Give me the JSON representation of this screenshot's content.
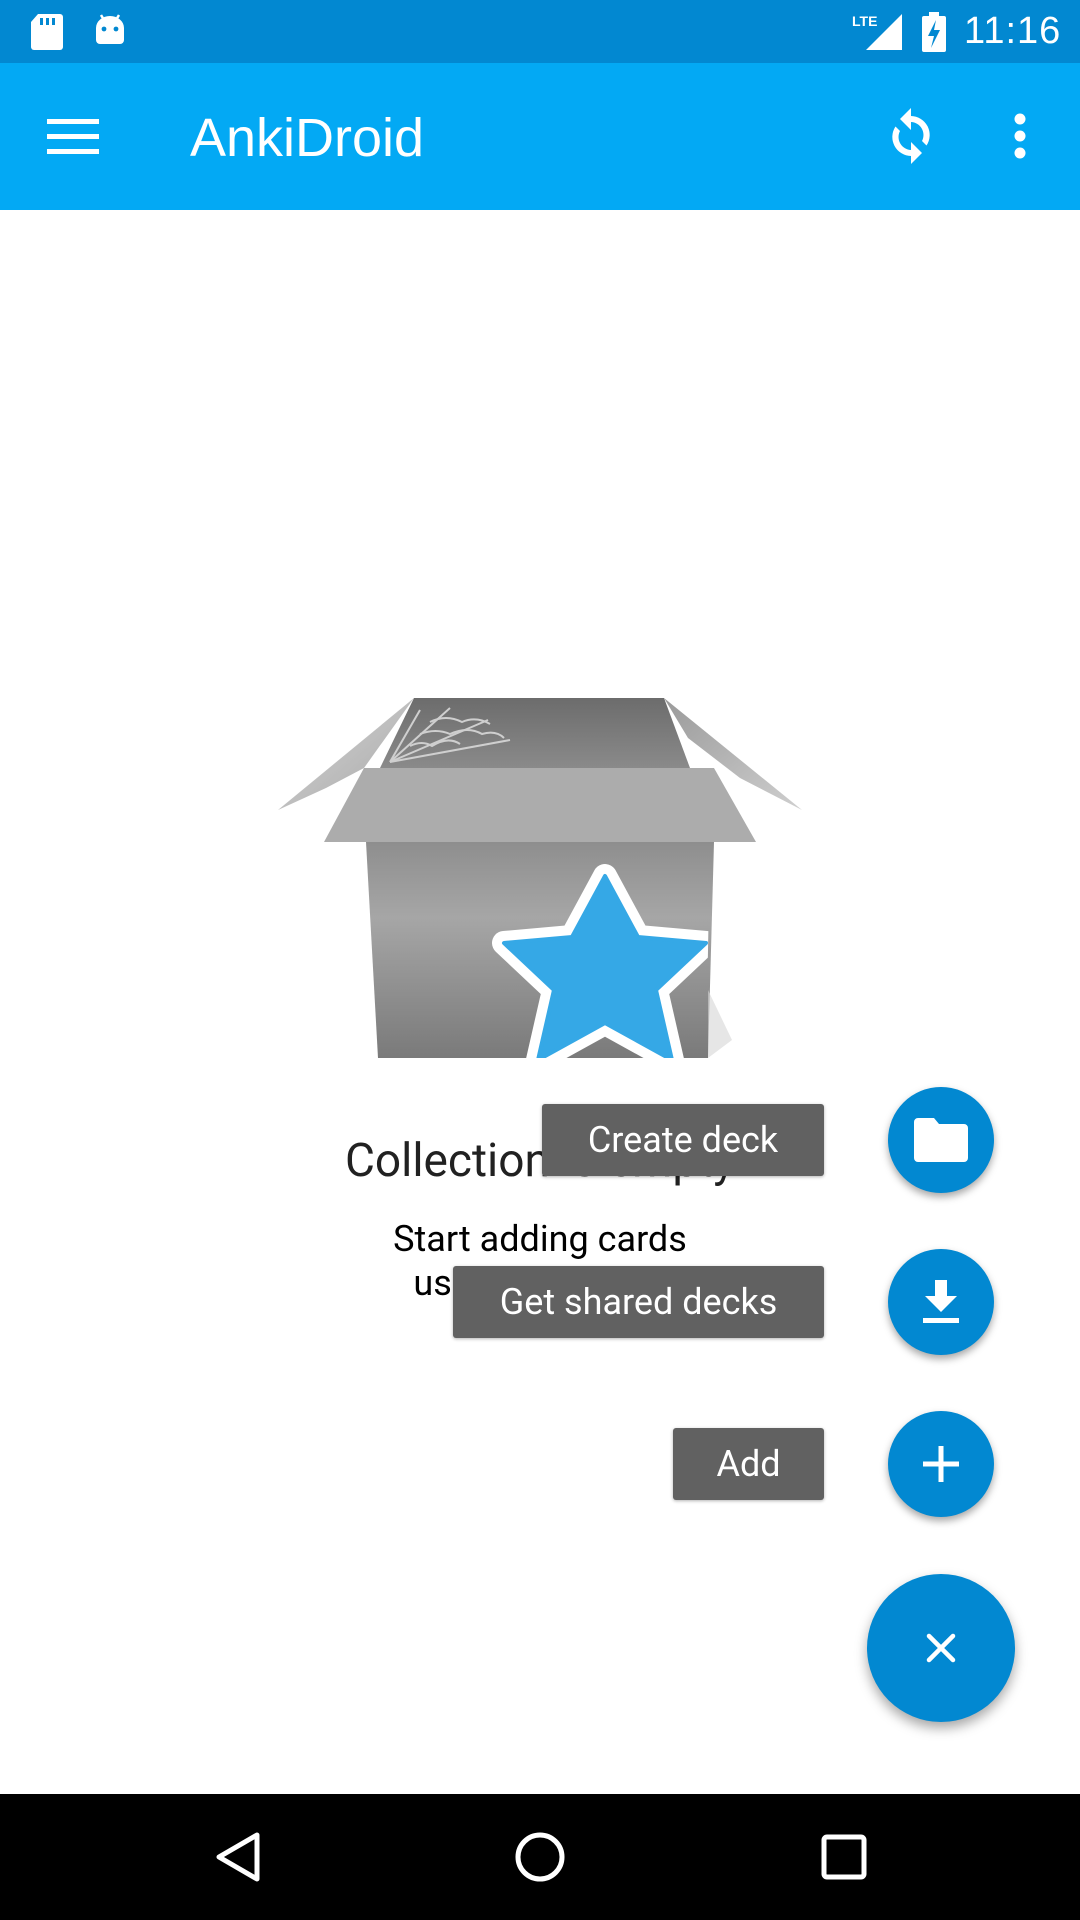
{
  "status_bar": {
    "time": "11:16",
    "network": "LTE",
    "icons": [
      "sd-card-icon",
      "android-debug-icon",
      "lte-signal-icon",
      "battery-charging-icon"
    ]
  },
  "app_bar": {
    "title": "AnkiDroid",
    "icons": [
      "menu-icon",
      "sync-icon",
      "overflow-menu-icon"
    ],
    "background": "#03a9f4"
  },
  "empty_state": {
    "title": "Collection is empty",
    "body_line1": "Start adding cards",
    "body_line2": "using the + icon"
  },
  "fab_menu": {
    "create_deck_label": "Create deck",
    "get_shared_decks_label": "Get shared decks",
    "add_label": "Add",
    "main_icon": "close-icon",
    "accent": "#0288d1"
  },
  "nav_bar": {
    "icons": [
      "back-icon",
      "home-icon",
      "recents-icon"
    ]
  }
}
